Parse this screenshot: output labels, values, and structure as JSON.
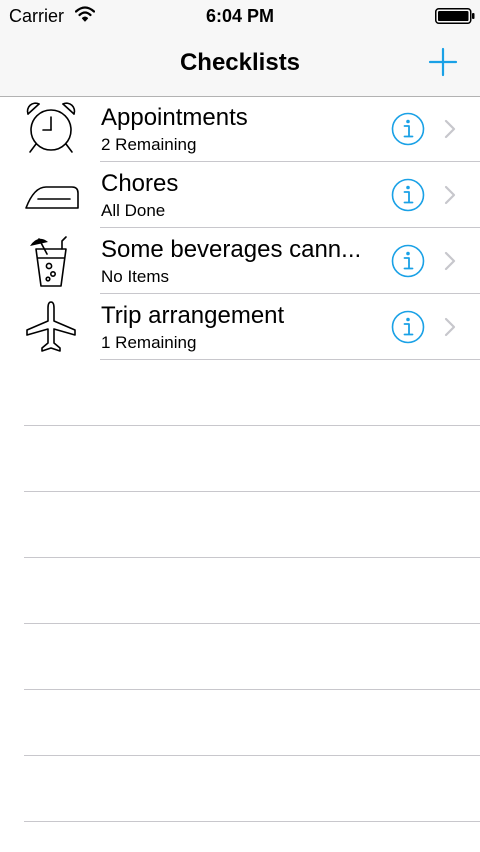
{
  "status_bar": {
    "carrier": "Carrier",
    "time": "6:04 PM",
    "wifi_icon": "wifi-icon",
    "battery_icon": "battery-full-icon"
  },
  "nav": {
    "title": "Checklists",
    "add_icon": "plus-icon"
  },
  "colors": {
    "tint": "#1aa1e6",
    "separator": "#c8c7cc",
    "chevron": "#c7c7cc",
    "navbar_bg": "#f7f7f7"
  },
  "checklists": [
    {
      "title": "Appointments",
      "subtitle": "2 Remaining",
      "icon": "alarm-clock-icon"
    },
    {
      "title": "Chores",
      "subtitle": "All Done",
      "icon": "iron-icon"
    },
    {
      "title": "Some beverages cann...",
      "subtitle": "No Items",
      "icon": "drink-icon"
    },
    {
      "title": "Trip arrangement",
      "subtitle": "1 Remaining",
      "icon": "airplane-icon"
    }
  ]
}
